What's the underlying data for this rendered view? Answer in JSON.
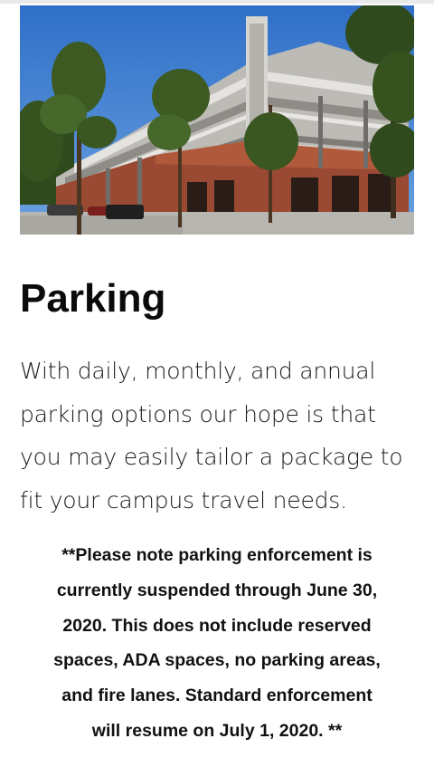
{
  "hero": {
    "alt": "Multi-level parking deck surrounded by pine trees"
  },
  "page": {
    "title": "Parking",
    "intro_lines": [
      "With daily, monthly, and annual",
      "parking options our hope is that",
      "you may easily tailor a package to",
      "fit your campus travel needs."
    ],
    "notice_lines": [
      "**Please note parking enforcement is",
      "currently suspended through June 30,",
      "2020. This does not include reserved",
      "spaces, ADA spaces, no parking areas,",
      "and fire lanes. Standard enforcement",
      "will resume on July 1, 2020. **"
    ]
  },
  "colors": {
    "sky": "#3f7fd2",
    "brick": "#9a4a32",
    "concrete": "#c9c7c2",
    "pine": "#3c5a22",
    "text": "#111111"
  }
}
